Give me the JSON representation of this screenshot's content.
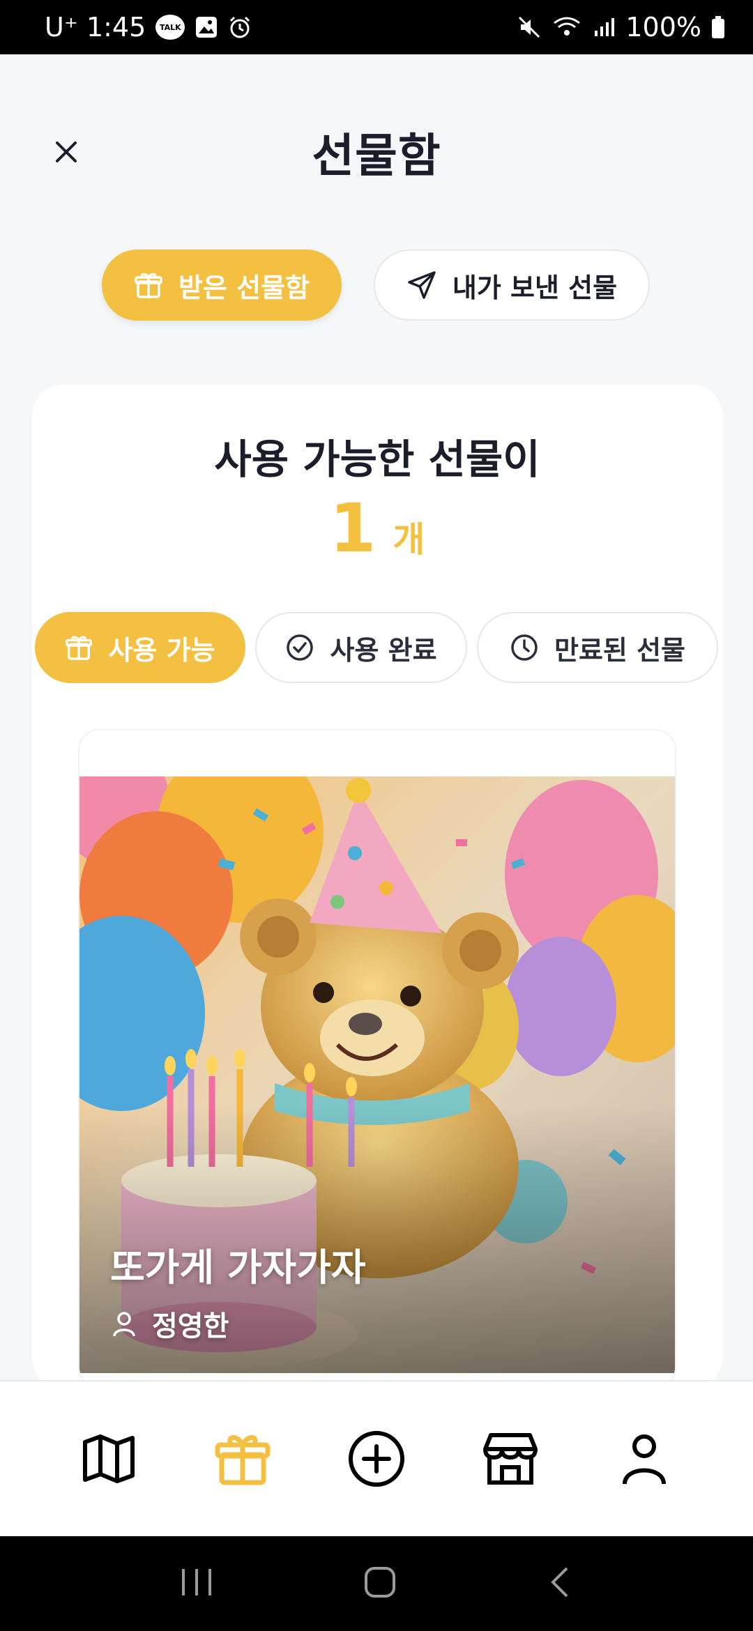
{
  "status_bar": {
    "carrier_time": "U⁺ 1:45",
    "talk_badge": "TALK",
    "battery": "100%"
  },
  "header": {
    "title": "선물함"
  },
  "segments": {
    "received": "받은 선물함",
    "sent": "내가 보낸 선물"
  },
  "summary": {
    "title": "사용 가능한 선물이",
    "count": "1",
    "unit": "개"
  },
  "filters": {
    "available": "사용 가능",
    "used": "사용 완료",
    "expired": "만료된 선물"
  },
  "gift": {
    "name": "또가게 가자가자",
    "sender": "정영한"
  },
  "nav": {
    "items": [
      "map-icon",
      "gift-icon",
      "add-icon",
      "store-icon",
      "profile-icon"
    ],
    "active_color": "#f4c042"
  },
  "colors": {
    "accent": "#f4c042",
    "text": "#1b1d2a"
  }
}
